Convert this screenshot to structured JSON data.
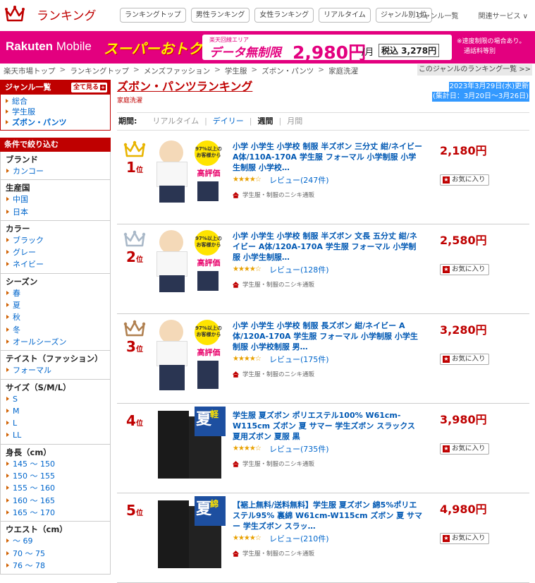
{
  "header": {
    "logo_text": "ランキング",
    "buttons": [
      "ランキングトップ",
      "男性ランキング",
      "女性ランキング",
      "リアルタイム",
      "ジャンル別1位"
    ],
    "links": [
      "ジャンル一覧",
      "関連サービス ∨"
    ]
  },
  "banner": {
    "brand_bold": "Rakuten",
    "brand_light": " Mobile",
    "super": "スーパーおトク",
    "area_note": "楽天回線エリア",
    "unlimited": "データ無制限",
    "price": "2,980円",
    "per_month": "/月",
    "tax_incl": "税込 3,278円",
    "note1": "※速度制限の場合あり。",
    "note2": "通話料等別"
  },
  "breadcrumb": {
    "items": [
      "楽天市場トップ",
      "ランキングトップ",
      "メンズファッション",
      "学生服",
      "ズボン・パンツ",
      "家庭洗濯"
    ],
    "separator": ">",
    "right_link": "このジャンルのランキング一覧 >>"
  },
  "sidebar": {
    "genre_title": "ジャンル一覧",
    "show_all": "全て見る",
    "genres": [
      "総合",
      "学生服",
      "ズボン・パンツ"
    ],
    "filter_title": "条件で絞り込む",
    "groups": [
      {
        "title": "ブランド",
        "items": [
          "カンコー"
        ]
      },
      {
        "title": "生産国",
        "items": [
          "中国",
          "日本"
        ]
      },
      {
        "title": "カラー",
        "items": [
          "ブラック",
          "グレー",
          "ネイビー"
        ]
      },
      {
        "title": "シーズン",
        "items": [
          "春",
          "夏",
          "秋",
          "冬",
          "オールシーズン"
        ]
      },
      {
        "title": "テイスト（ファッション）",
        "items": [
          "フォーマル"
        ]
      },
      {
        "title": "サイズ（S/M/L）",
        "items": [
          "S",
          "M",
          "L",
          "LL"
        ]
      },
      {
        "title": "身長（cm）",
        "items": [
          "145 ～ 150",
          "150 ～ 155",
          "155 ～ 160",
          "160 ～ 165",
          "165 ～ 170"
        ]
      },
      {
        "title": "ウエスト（cm）",
        "items": [
          "～ 69",
          "70 ～ 75",
          "76 ～ 78"
        ]
      }
    ]
  },
  "main": {
    "title": "ズボン・パンツランキング",
    "subtitle": "家庭洗濯",
    "updated": "2023年3月29日(水)更新",
    "range": "(集計日：3月20日～3月26日)",
    "period_label": "期間:",
    "periods": [
      "リアルタイム",
      "デイリー",
      "週間",
      "月間"
    ],
    "items": [
      {
        "rank": "1",
        "rank_suffix": "位",
        "title": "小学 小学生 小学校 制服 半ズボン 三分丈 紺/ネイビー A体/110A-170A 学生服 フォーマル 小学制服 小学生制服 小学校…",
        "stars": "★★★★☆",
        "review": "レビュー(247件)",
        "shop": "学生服・制服のニシキ通販",
        "price": "2,180円",
        "fav": "お気に入り",
        "crown": "#e8b400"
      },
      {
        "rank": "2",
        "rank_suffix": "位",
        "title": "小学 小学生 小学校 制服 半ズボン 文長 五分丈 紺/ネイビー A体/120A-170A 学生服 フォーマル 小学制服 小学生制服…",
        "stars": "★★★★☆",
        "review": "レビュー(128件)",
        "shop": "学生服・制服のニシキ通販",
        "price": "2,580円",
        "fav": "お気に入り",
        "crown": "#a9b8c8"
      },
      {
        "rank": "3",
        "rank_suffix": "位",
        "title": "小学 小学生 小学校 制服 長ズボン 紺/ネイビー A体/120A-170A 学生服 フォーマル 小学制服 小学生制服 小学校制服 男…",
        "stars": "★★★★☆",
        "review": "レビュー(175件)",
        "shop": "学生服・制服のニシキ通販",
        "price": "3,280円",
        "fav": "お気に入り",
        "crown": "#b08050"
      },
      {
        "rank": "4",
        "rank_suffix": "位",
        "title": "学生服 夏ズボン ポリエステル100% W61cm-W115cm ズボン 夏 サマー 学生ズボン スラックス 夏用ズボン 夏服 黒",
        "stars": "★★★★☆",
        "review": "レビュー(735件)",
        "shop": "学生服・制服のニシキ通販",
        "price": "3,980円",
        "fav": "お気に入り",
        "crown": ""
      },
      {
        "rank": "5",
        "rank_suffix": "位",
        "title": "【裾上無料/送料無料】学生服 夏ズボン 綿5%ポリエステル95% 裏綿 W61cm-W115cm ズボン 夏 サマー 学生ズボン スラッ…",
        "stars": "★★★★☆",
        "review": "レビュー(210件)",
        "shop": "学生服・制服のニシキ通販",
        "price": "4,980円",
        "fav": "お気に入り",
        "crown": ""
      }
    ]
  },
  "thumb_text": {
    "badge_top": "97%以上の",
    "badge_mid": "お客様から",
    "badge_bottom": "高評価",
    "summer": "夏",
    "kei": "軽",
    "men": "綿"
  },
  "colors": {
    "brand": "#bf0000",
    "banner": "#e3007f",
    "link": "#0066cc"
  }
}
